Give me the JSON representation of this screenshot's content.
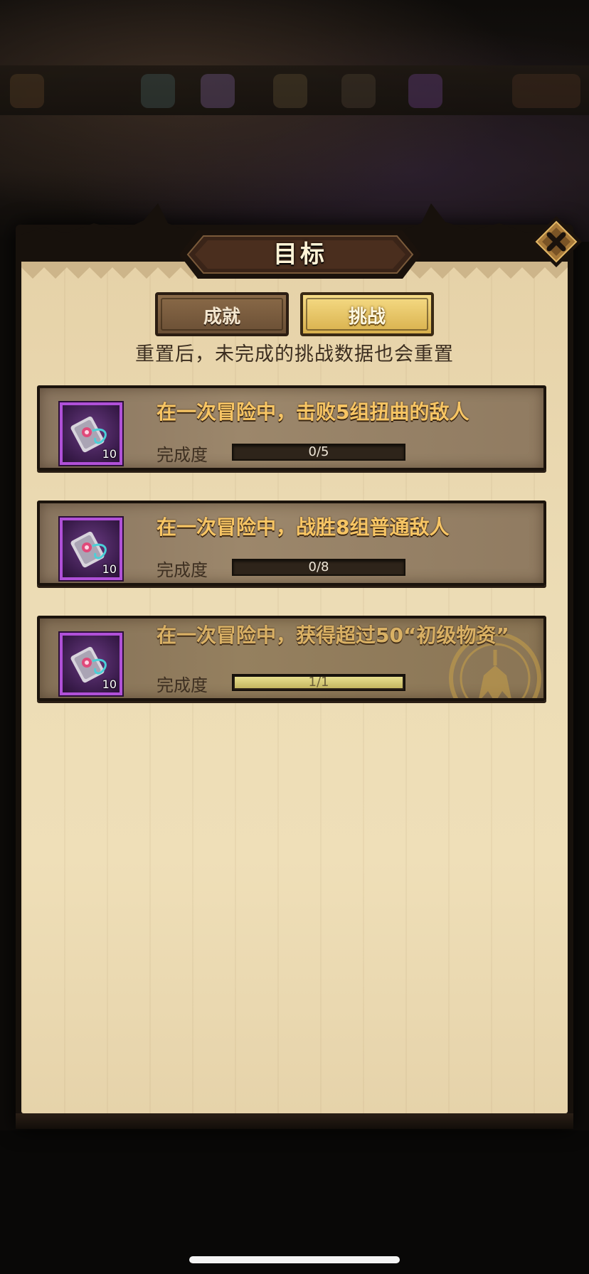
{
  "dialog": {
    "title": "目标",
    "close_icon": "close-x-icon"
  },
  "tabs": [
    {
      "label": "成就",
      "active": false
    },
    {
      "label": "挑战",
      "active": true
    }
  ],
  "notice": "重置后，未完成的挑战数据也会重置",
  "progress_label": "完成度",
  "challenges": [
    {
      "description": "在一次冒险中，击败5组扭曲的敌人",
      "reward_icon": "purple-scroll-icon",
      "reward_count": "10",
      "progress_text": "0/5",
      "progress_fraction": 0,
      "completed": false
    },
    {
      "description": "在一次冒险中，战胜8组普通敌人",
      "reward_icon": "purple-scroll-icon",
      "reward_count": "10",
      "progress_text": "0/8",
      "progress_fraction": 0,
      "completed": false
    },
    {
      "description": "在一次冒险中，获得超过50“初级物资”",
      "reward_icon": "purple-scroll-icon",
      "reward_count": "10",
      "progress_text": "1/1",
      "progress_fraction": 1,
      "completed": true
    }
  ],
  "colors": {
    "parchment": "#ecdcb5",
    "card": "#9c876b",
    "gold_text": "#f7c564",
    "rarity_purple": "#b050d8",
    "progress_fill": "#e8df8e"
  }
}
